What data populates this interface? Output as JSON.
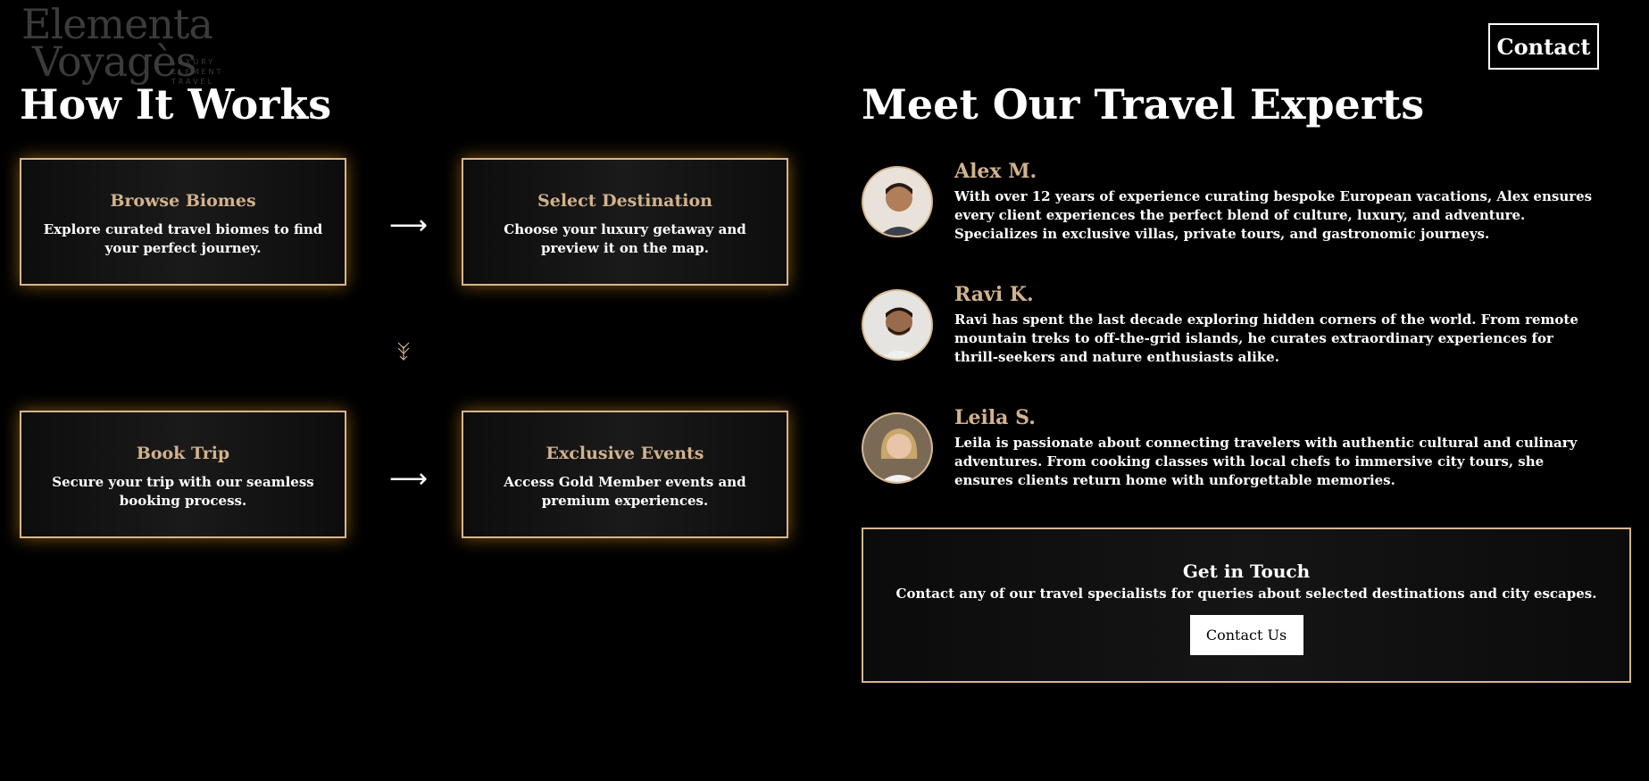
{
  "logo": {
    "line1": "Elementa",
    "line2": "Voyagès",
    "tagline": [
      "LUXURY",
      "ELEMENT",
      "TRAVEL"
    ]
  },
  "header": {
    "contact_label": "Contact"
  },
  "how_it_works": {
    "title": "How It Works",
    "steps": [
      {
        "title": "Browse Biomes",
        "description": "Explore curated travel biomes to find your perfect journey."
      },
      {
        "title": "Select Destination",
        "description": "Choose your luxury getaway and preview it on the map."
      },
      {
        "title": "Book Trip",
        "description": "Secure your trip with our seamless booking process."
      },
      {
        "title": "Exclusive Events",
        "description": "Access Gold Member events and premium experiences."
      }
    ],
    "arrow_right": "⟶",
    "arrow_down": "⩡"
  },
  "experts": {
    "title": "Meet Our Travel Experts",
    "list": [
      {
        "name": "Alex M.",
        "bio": "With over 12 years of experience curating bespoke European vacations, Alex ensures every client experiences the perfect blend of culture, luxury, and adventure. Specializes in exclusive villas, private tours, and gastronomic journeys."
      },
      {
        "name": "Ravi K.",
        "bio": "Ravi has spent the last decade exploring hidden corners of the world. From remote mountain treks to off-the-grid islands, he curates extraordinary experiences for thrill-seekers and nature enthusiasts alike."
      },
      {
        "name": "Leila S.",
        "bio": "Leila is passionate about connecting travelers with authentic cultural and culinary adventures. From cooking classes with local chefs to immersive city tours, she ensures clients return home with unforgettable memories."
      }
    ]
  },
  "get_in_touch": {
    "title": "Get in Touch",
    "description": "Contact any of our travel specialists for queries about selected destinations and city escapes.",
    "button_label": "Contact Us"
  },
  "colors": {
    "background": "#000000",
    "accent_gold": "#d2b28c",
    "border_gold": "#d6b68d",
    "glow": "#e09628"
  }
}
